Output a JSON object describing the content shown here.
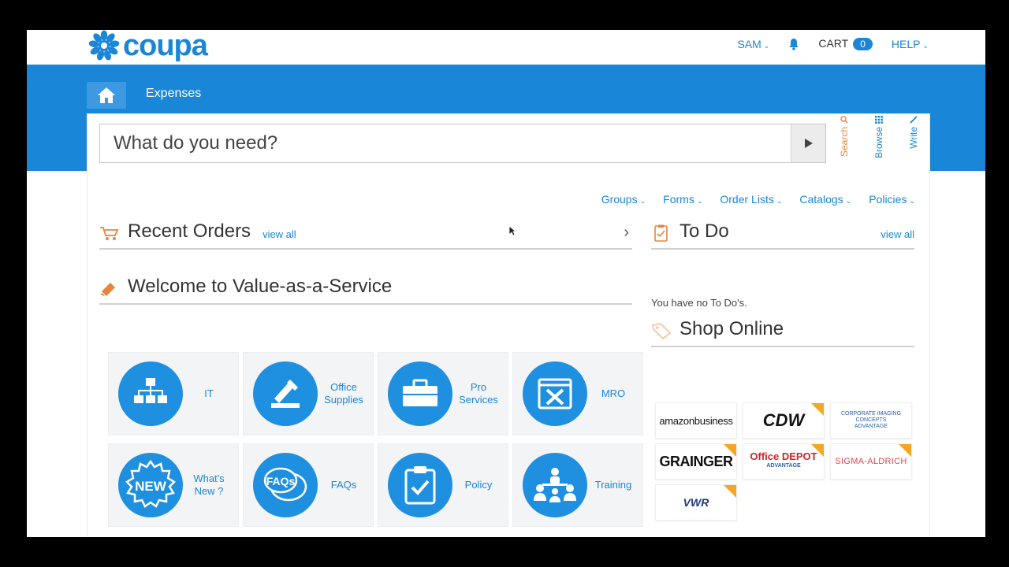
{
  "header": {
    "logo_text": "coupa",
    "user": "SAM",
    "cart_label": "CART",
    "cart_count": "0",
    "help": "HELP"
  },
  "tabs": {
    "expenses": "Expenses"
  },
  "search": {
    "placeholder": "What do you need?",
    "side_tabs": [
      "Search",
      "Browse",
      "Write"
    ]
  },
  "subnav": [
    "Groups",
    "Forms",
    "Order Lists",
    "Catalogs",
    "Policies"
  ],
  "recent_orders": {
    "title": "Recent Orders",
    "view_all": "view all"
  },
  "todo": {
    "title": "To Do",
    "view_all": "view all",
    "empty": "You have no To Do's."
  },
  "welcome": {
    "title": "Welcome to Value-as-a-Service"
  },
  "tiles": [
    {
      "label": "IT",
      "icon": "org-chart-icon"
    },
    {
      "label": "Office Supplies",
      "icon": "pencil-paper-icon"
    },
    {
      "label": "Pro Services",
      "icon": "briefcase-icon"
    },
    {
      "label": "MRO",
      "icon": "tools-icon"
    },
    {
      "label": "What's New ?",
      "icon": "new-badge-icon"
    },
    {
      "label": "FAQs",
      "icon": "faq-bubbles-icon"
    },
    {
      "label": "Policy",
      "icon": "clipboard-check-icon"
    },
    {
      "label": "Training",
      "icon": "training-icon"
    }
  ],
  "shop_online": {
    "title": "Shop Online",
    "stores": [
      "amazonbusiness",
      "CDW",
      "CORPORATE IMAGING CONCEPTS",
      "GRAINGER",
      "Office DEPOT",
      "SIGMA-ALDRICH",
      "VWR"
    ],
    "store_subtext": {
      "ci": "ADVANTAGE",
      "od": "ADVANTAGE"
    }
  },
  "colors": {
    "brand_blue": "#1a86d8",
    "accent_orange": "#f5a623"
  }
}
